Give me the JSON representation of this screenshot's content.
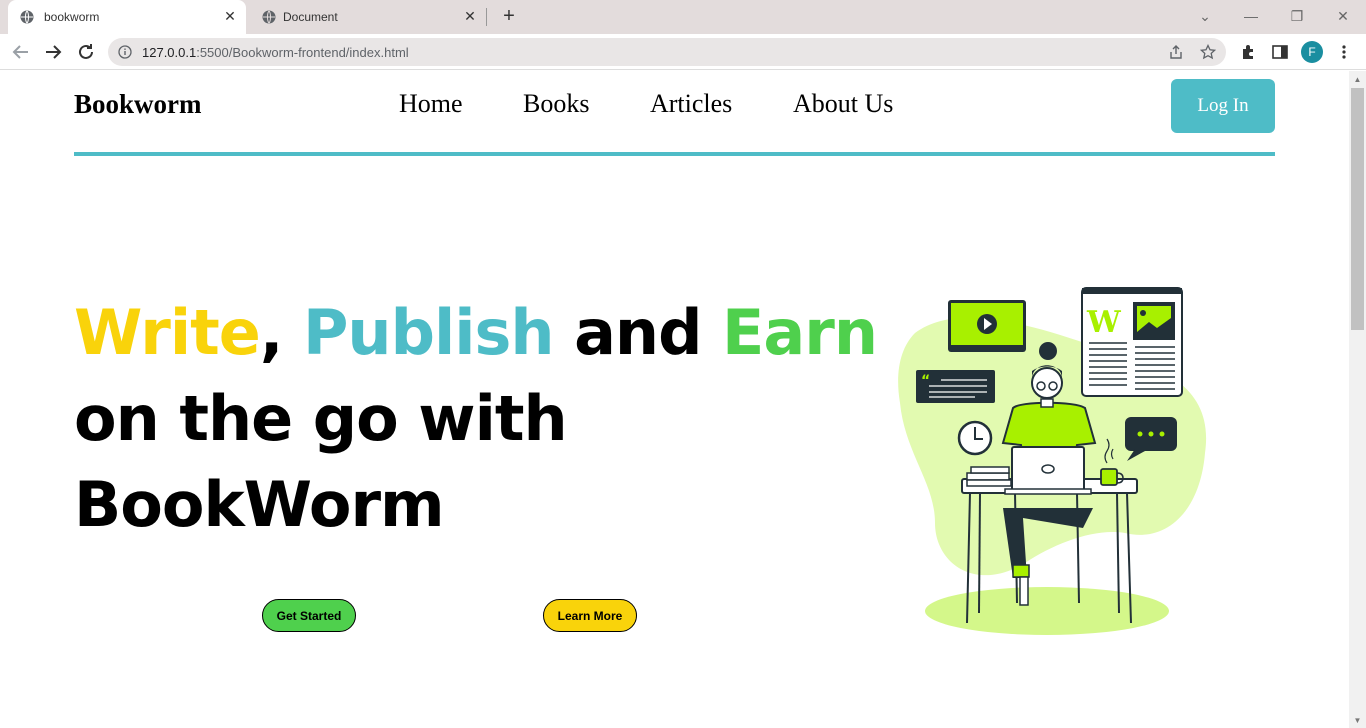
{
  "browser": {
    "tabs": [
      {
        "title": "bookworm",
        "active": true
      },
      {
        "title": "Document",
        "active": false
      }
    ],
    "url_host": "127.0.0.1",
    "url_rest": ":5500/Bookworm-frontend/index.html",
    "profile_initial": "F"
  },
  "nav": {
    "brand": "Bookworm",
    "links": [
      "Home",
      "Books",
      "Articles",
      "About Us"
    ],
    "login_label": "Log In"
  },
  "hero": {
    "word_write": "Write",
    "comma": ",",
    "word_publish": "Publish",
    "word_and": "and",
    "word_earn": "Earn",
    "line2": "on the go with",
    "line3": "BookWorm",
    "get_started": "Get Started",
    "learn_more": "Learn More"
  },
  "colors": {
    "accent_teal": "#4ebcc7",
    "accent_yellow": "#f9d30b",
    "accent_green": "#4fd04d",
    "illustration_lime": "#a8f000"
  }
}
